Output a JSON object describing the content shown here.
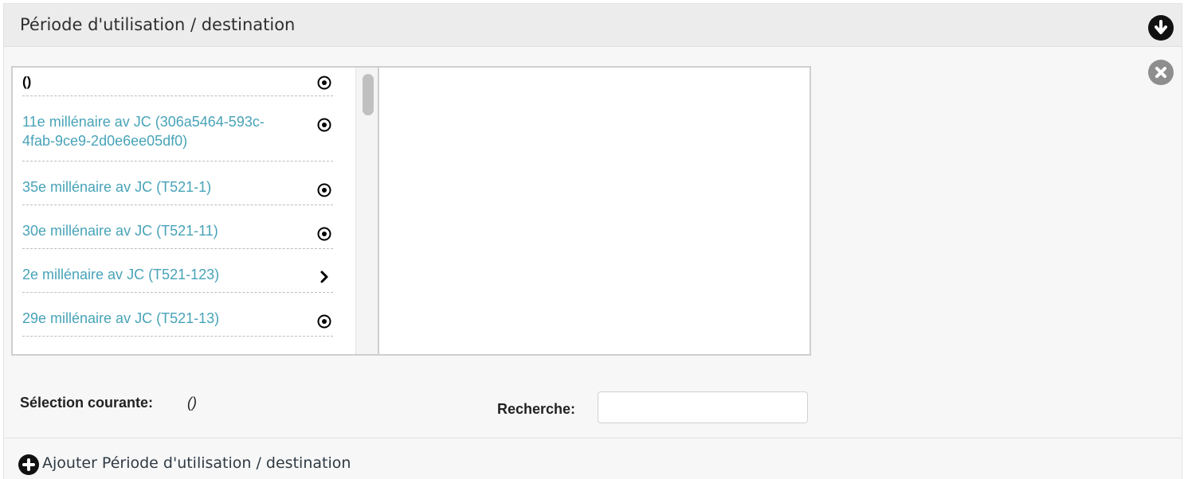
{
  "panel": {
    "title": "Période d'utilisation / destination",
    "toggle_icon": "arrow-down-circle-icon",
    "close_icon": "close-circle-icon"
  },
  "tree": {
    "items": [
      {
        "label": "()",
        "action": "target-icon"
      },
      {
        "label": "11e millénaire av JC (306a5464-593c-4fab-9ce9-2d0e6ee05df0)",
        "action": "target-icon"
      },
      {
        "label": "35e millénaire av JC (T521-1)",
        "action": "target-icon"
      },
      {
        "label": "30e millénaire av JC (T521-11)",
        "action": "target-icon"
      },
      {
        "label": "2e millénaire av JC (T521-123)",
        "action": "chevron-right-icon"
      },
      {
        "label": "29e millénaire av JC (T521-13)",
        "action": "target-icon"
      }
    ]
  },
  "selection": {
    "label": "Sélection courante:",
    "value": "()"
  },
  "search": {
    "label": "Recherche:",
    "value": "",
    "placeholder": ""
  },
  "footer": {
    "add_label": "Ajouter Période d'utilisation / destination",
    "add_icon": "plus-circle-icon"
  },
  "colors": {
    "link": "#47a3b8",
    "header_bg": "#ececec",
    "panel_bg": "#f7f7f7"
  }
}
